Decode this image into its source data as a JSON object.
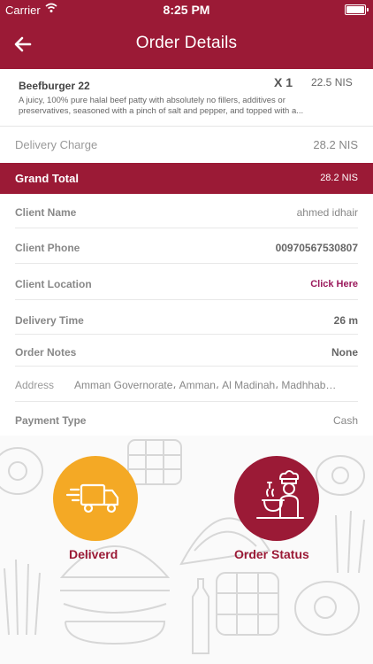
{
  "status_bar": {
    "carrier": "Carrier",
    "time": "8:25 PM"
  },
  "header": {
    "title": "Order Details"
  },
  "item": {
    "name": "Beefburger 22",
    "quantity": "X 1",
    "price": "22.5 NIS",
    "description_line1": "A juicy, 100% pure halal beef patty with absolutely no fillers, additives or",
    "description_line2": "preservatives, seasoned with a pinch of salt and pepper, and topped with a..."
  },
  "delivery_charge": {
    "label": "Delivery Charge",
    "value": "28.2 NIS"
  },
  "grand_total": {
    "label": "Grand Total",
    "value": "28.2 NIS"
  },
  "client": {
    "name_label": "Client Name",
    "name_value": "ahmed idhair",
    "phone_label": "Client Phone",
    "phone_value": "00970567530807",
    "location_label": "Client Location",
    "location_value": "Click Here"
  },
  "delivery_time": {
    "label": "Delivery Time",
    "value": "26 m"
  },
  "order_notes": {
    "label": "Order Notes",
    "value": "None"
  },
  "address": {
    "label": "Address",
    "value": "Amman Governorate، Amman، Al Madinah، Madhhab…"
  },
  "payment": {
    "label": "Payment Type",
    "value": "Cash"
  },
  "actions": {
    "delivered_label": "Deliverd",
    "order_status_label": "Order Status"
  },
  "colors": {
    "brand": "#9b1a36",
    "accent_yellow": "#f4a925",
    "link": "#9b1a5c"
  },
  "icons": {
    "back": "arrow-left-icon",
    "truck": "delivery-truck-icon",
    "chef": "chef-cooking-icon",
    "wifi": "wifi-icon",
    "battery": "battery-icon"
  }
}
